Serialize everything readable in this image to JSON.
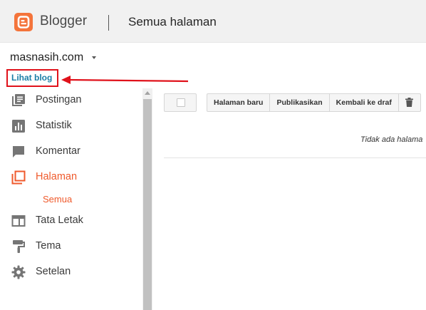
{
  "header": {
    "brand": "Blogger",
    "page_title": "Semua halaman"
  },
  "blog": {
    "name": "masnasih.com",
    "view_blog": "Lihat blog"
  },
  "annotation": {
    "color": "#e0121b"
  },
  "colors": {
    "brand": "#f4743b",
    "active": "#ef5a2c",
    "link": "#1b7ea6"
  },
  "sidebar": {
    "items": [
      {
        "label": "Postingan",
        "icon": "posts-icon"
      },
      {
        "label": "Statistik",
        "icon": "stats-icon"
      },
      {
        "label": "Komentar",
        "icon": "comments-icon"
      },
      {
        "label": "Halaman",
        "icon": "pages-icon",
        "active": true
      },
      {
        "label": "Tata Letak",
        "icon": "layout-icon"
      },
      {
        "label": "Tema",
        "icon": "theme-icon"
      },
      {
        "label": "Setelan",
        "icon": "settings-icon"
      }
    ],
    "sub_item": "Semua"
  },
  "toolbar": {
    "new_page": "Halaman baru",
    "publish": "Publikasikan",
    "revert_draft": "Kembali ke draf",
    "delete_icon": "trash-icon"
  },
  "main": {
    "empty_message": "Tidak ada halama"
  }
}
